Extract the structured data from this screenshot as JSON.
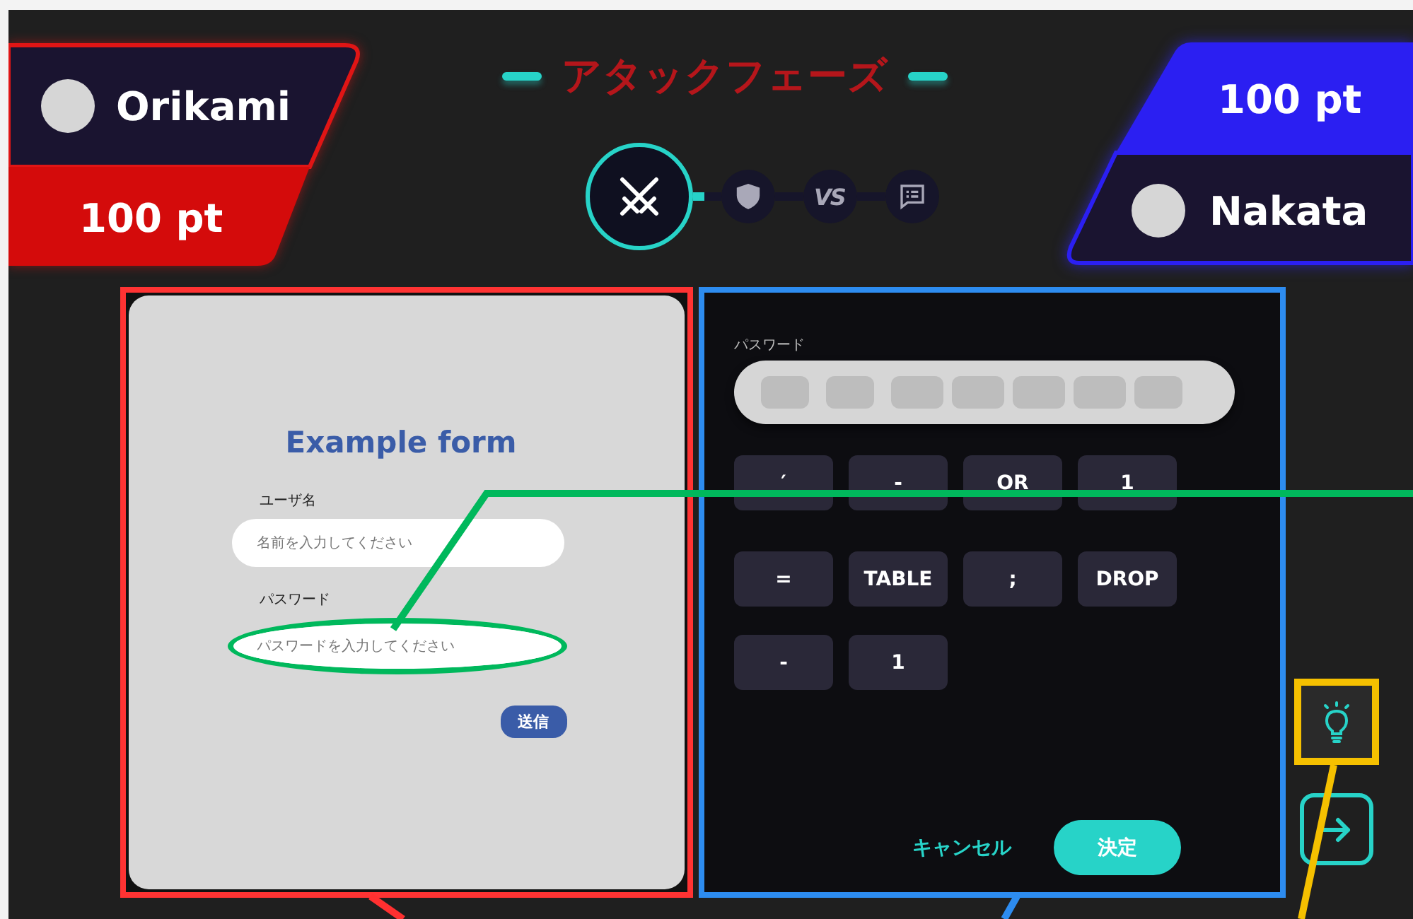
{
  "players": [
    {
      "kind": "left",
      "name": "Orikami",
      "score": "100 pt",
      "color": "#d40b0b"
    },
    {
      "kind": "right",
      "name": "Nakata",
      "score": "100 pt",
      "color": "#2b1ff2"
    }
  ],
  "phase": {
    "title": "アタックフェーズ",
    "steps": [
      {
        "kind": "attack",
        "selected": true
      },
      {
        "kind": "defense",
        "selected": false
      },
      {
        "kind": "versus",
        "label": "VS",
        "selected": false
      },
      {
        "kind": "review",
        "selected": false
      }
    ]
  },
  "target_form": {
    "title": "Example form",
    "fields": [
      {
        "label": "ユーザ名",
        "placeholder": "名前を入力してください",
        "highlighted": false
      },
      {
        "label": "パスワード",
        "placeholder": "パスワードを入力してください",
        "highlighted": true
      }
    ],
    "submit": "送信"
  },
  "builder": {
    "label": "パスワード",
    "tokens": [
      [
        "′",
        "-",
        "OR",
        "1"
      ],
      [
        "=",
        "TABLE",
        ";",
        "DROP"
      ],
      [
        "-",
        "1"
      ]
    ],
    "cancel": "キャンセル",
    "confirm": "決定"
  },
  "side_buttons": [
    {
      "kind": "hint",
      "highlighted": true
    },
    {
      "kind": "next",
      "highlighted": false
    }
  ]
}
